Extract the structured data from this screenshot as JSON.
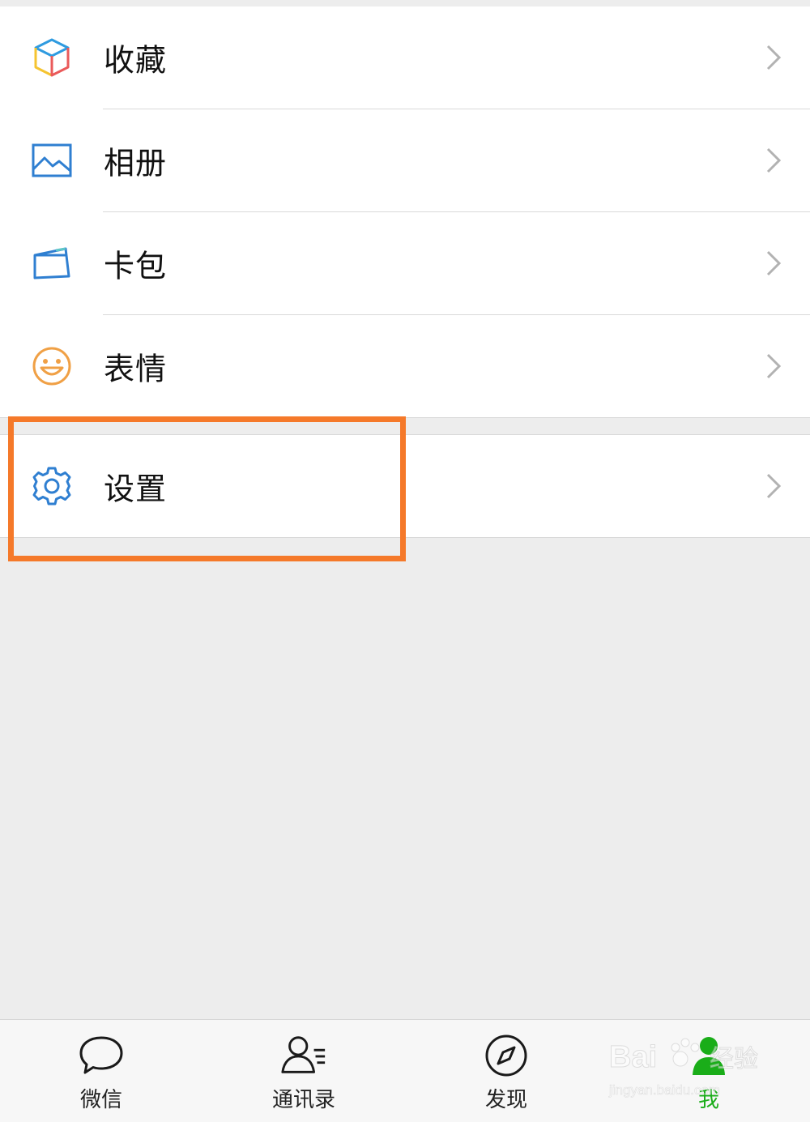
{
  "menu": {
    "group1": [
      {
        "label": "收藏",
        "icon": "favorites-cube-icon"
      },
      {
        "label": "相册",
        "icon": "album-picture-icon"
      },
      {
        "label": "卡包",
        "icon": "card-wallet-icon"
      },
      {
        "label": "表情",
        "icon": "sticker-smiley-icon"
      }
    ],
    "group2": [
      {
        "label": "设置",
        "icon": "settings-gear-icon"
      }
    ]
  },
  "tabbar": {
    "tabs": [
      {
        "label": "微信",
        "icon": "chat-bubble-icon",
        "active": false
      },
      {
        "label": "通讯录",
        "icon": "contacts-icon",
        "active": false
      },
      {
        "label": "发现",
        "icon": "compass-icon",
        "active": false
      },
      {
        "label": "我",
        "icon": "me-person-icon",
        "active": true
      }
    ]
  },
  "colors": {
    "accent_green": "#1aad19",
    "highlight_orange": "#f5792a",
    "icon_blue": "#2f7fd1",
    "icon_orange": "#f0a045"
  },
  "watermark": {
    "brand": "Bai",
    "brand_cn": "经验",
    "url": "jingyan.baidu.com"
  }
}
